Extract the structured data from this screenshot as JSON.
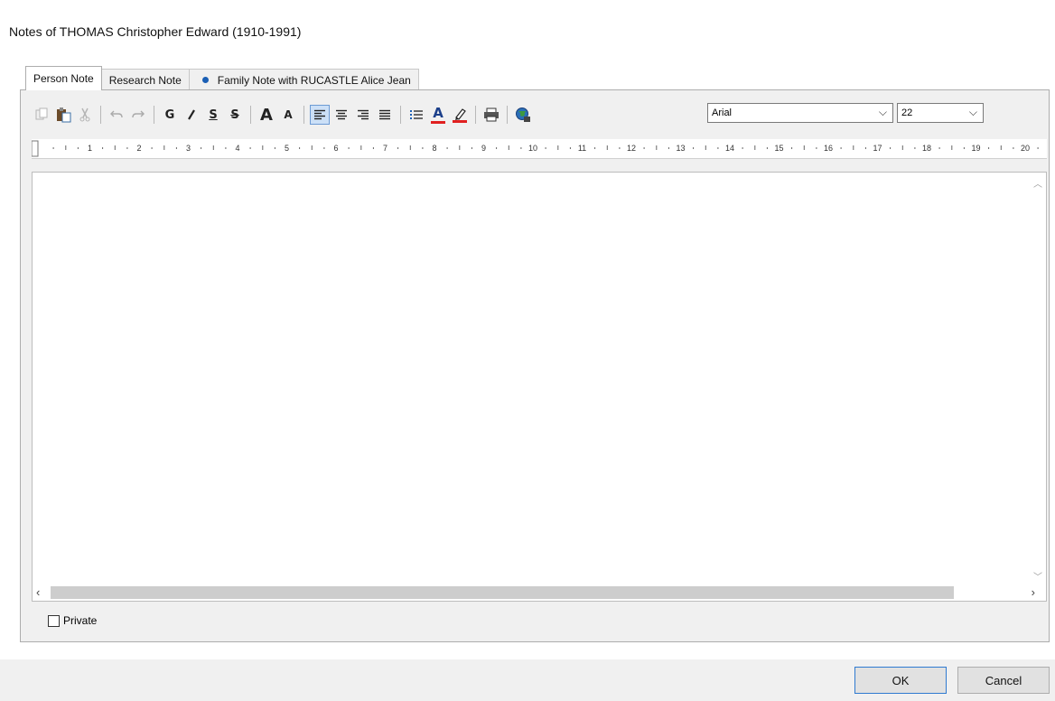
{
  "window": {
    "title": "Notes of THOMAS Christopher Edward (1910-1991)"
  },
  "tabs": [
    {
      "label": "Person Note",
      "active": true
    },
    {
      "label": "Research Note",
      "active": false
    },
    {
      "label": "Family Note with RUCASTLE Alice Jean",
      "active": false,
      "icon": "dot-icon"
    }
  ],
  "toolbar": {
    "groups": [
      [
        "copy-icon",
        "paste-icon",
        "cut-icon"
      ],
      [
        "undo-icon",
        "redo-icon"
      ],
      [
        "bold-icon",
        "italic-icon",
        "underline-icon",
        "strikethrough-icon"
      ],
      [
        "font-grow-icon",
        "font-shrink-icon"
      ],
      [
        "align-left-icon",
        "align-center-icon",
        "align-right-icon",
        "align-justify-icon"
      ],
      [
        "bullet-list-icon",
        "font-color-icon",
        "highlight-icon"
      ],
      [
        "print-icon"
      ],
      [
        "web-icon"
      ]
    ],
    "bold_label": "G",
    "italic_label": "I",
    "underline_label": "S",
    "strikethrough_label": "S",
    "font_grow_label": "A",
    "font_shrink_label": "A",
    "font_color_label": "A",
    "font_name": "Arial",
    "font_size": "22"
  },
  "ruler": {
    "labels": [
      "1",
      "2",
      "3",
      "4",
      "5",
      "6",
      "7",
      "8",
      "9",
      "10",
      "11",
      "12",
      "13",
      "14",
      "15",
      "16",
      "17",
      "18",
      "19",
      "20"
    ]
  },
  "options": {
    "private_label": "Private",
    "private_checked": false
  },
  "buttons": {
    "ok": "OK",
    "cancel": "Cancel"
  },
  "colors": {
    "accent": "#2f7ad0",
    "font_color_bar": "#e02020",
    "dot": "#1b5fb5"
  }
}
